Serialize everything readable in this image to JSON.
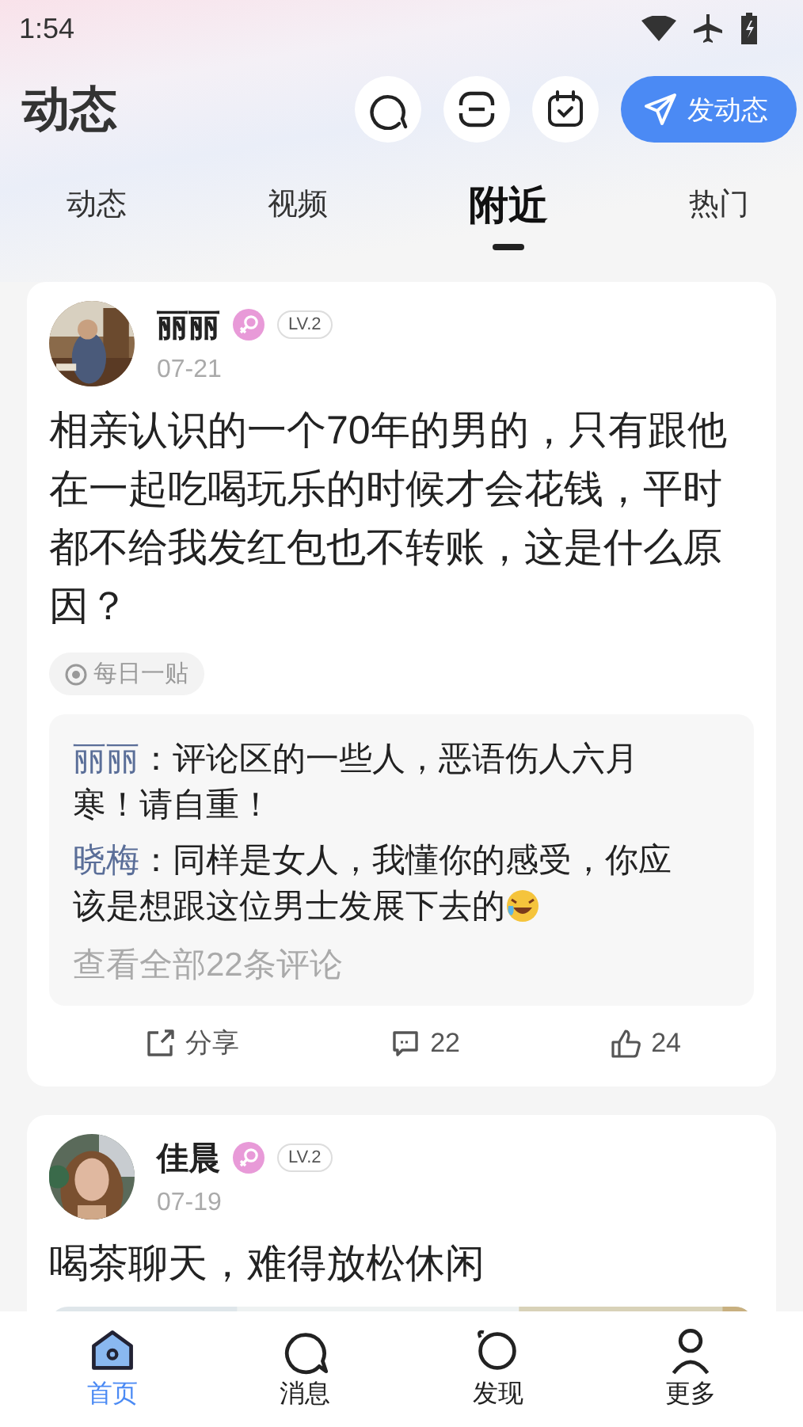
{
  "status_bar": {
    "time": "1:54"
  },
  "header": {
    "title": "动态",
    "post_button": "发动态"
  },
  "tabs": [
    {
      "label": "动态",
      "selected": false
    },
    {
      "label": "视频",
      "selected": false
    },
    {
      "label": "附近",
      "selected": true
    },
    {
      "label": "热门",
      "selected": false
    }
  ],
  "posts": [
    {
      "author": "丽丽",
      "level": "LV.2",
      "date": "07-21",
      "text": "相亲认识的一个70年的男的，只有跟他在一起吃喝玩乐的时候才会花钱，平时都不给我发红包也不转账，这是什么原因？",
      "topic": "每日一贴",
      "comments": [
        {
          "author": "丽丽",
          "text": "：评论区的一些人，恶语伤人六月寒！请自重！",
          "has_emoji": false
        },
        {
          "author": "晓梅",
          "text": "：同样是女人，我懂你的感受，你应该是想跟这位男士发展下去的",
          "has_emoji": true
        }
      ],
      "view_all": "查看全部22条评论",
      "share": "分享",
      "comment_count": "22",
      "like_count": "24"
    },
    {
      "author": "佳晨",
      "level": "LV.2",
      "date": "07-19",
      "text": "喝茶聊天，难得放松休闲"
    }
  ],
  "bottom_nav": [
    {
      "label": "首页",
      "selected": true
    },
    {
      "label": "消息",
      "selected": false
    },
    {
      "label": "发现",
      "selected": false
    },
    {
      "label": "更多",
      "selected": false
    }
  ]
}
